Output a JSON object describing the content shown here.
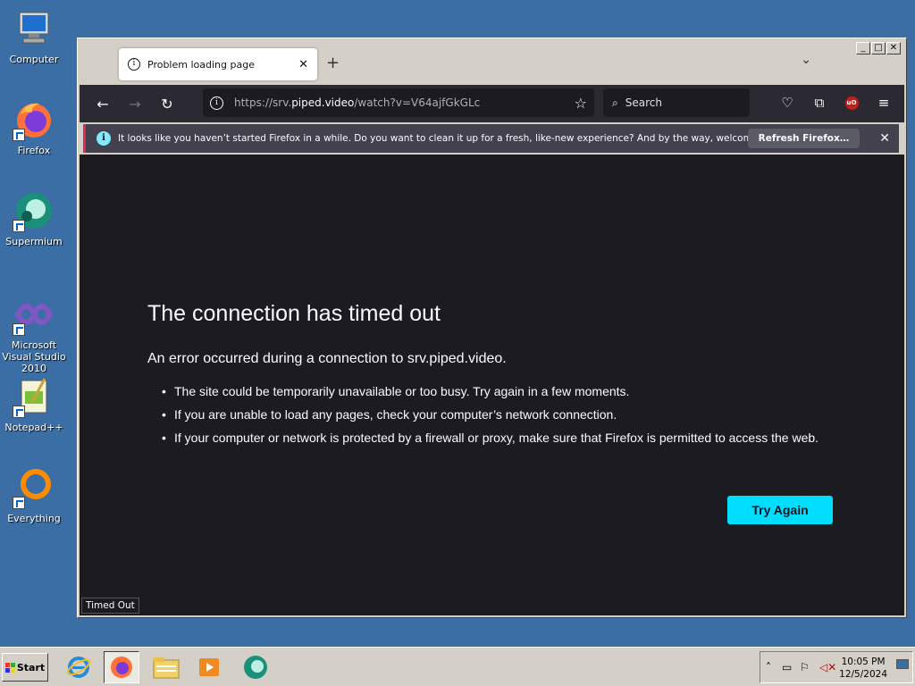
{
  "desktop": {
    "icons": [
      {
        "label": "Computer",
        "icon": "computer-icon"
      },
      {
        "label": "Firefox",
        "icon": "firefox-icon"
      },
      {
        "label": "Supermium",
        "icon": "supermium-icon"
      },
      {
        "label": "Microsoft Visual Studio 2010",
        "icon": "visual-studio-icon"
      },
      {
        "label": "Notepad++",
        "icon": "notepad-plus-plus-icon"
      },
      {
        "label": "Everything",
        "icon": "everything-icon"
      }
    ]
  },
  "browser": {
    "tab": {
      "title": "Problem loading page"
    },
    "url": {
      "scheme": "https://srv.",
      "host": "piped.video",
      "path": "/watch?v=V64ajfGkGLc"
    },
    "search_placeholder": "Search",
    "notification": {
      "message": "It looks like you haven’t started Firefox in a while. Do you want to clean it up for a fresh, like-new experience? And by the way, welcome back!",
      "button": "Refresh Firefox…"
    },
    "error": {
      "title": "The connection has timed out",
      "subtitle": "An error occurred during a connection to srv.piped.video.",
      "bullets": [
        "The site could be temporarily unavailable or too busy. Try again in a few moments.",
        "If you are unable to load any pages, check your computer’s network connection.",
        "If your computer or network is protected by a firewall or proxy, make sure that Firefox is permitted to access the web."
      ],
      "button": "Try Again"
    },
    "status": "Timed Out"
  },
  "taskbar": {
    "start_label": "Start",
    "apps": [
      "internet-explorer-icon",
      "firefox-icon",
      "file-explorer-icon",
      "media-player-icon",
      "supermium-icon"
    ],
    "clock": {
      "time": "10:05 PM",
      "date": "12/5/2024"
    }
  },
  "colors": {
    "accent": "#00ddff",
    "desktop": "#3a6ea5",
    "page_bg": "#1c1b22"
  }
}
